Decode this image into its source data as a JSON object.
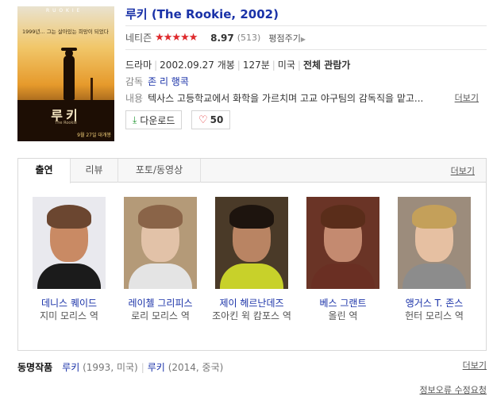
{
  "poster": {
    "top_text": "R U O K I E",
    "tagline": "1999년... 그는 살아있는 희망이 되었다",
    "title": "루키",
    "subtitle": "The Rookie",
    "date_text": "9월 27일 대개봉"
  },
  "movie": {
    "title": "루키 (The Rookie, 2002)",
    "rating_label": "네티즌",
    "rating": 8.97,
    "rating_text": "8.97",
    "rating_count": "(513)",
    "rate_link": "평점주기",
    "genre": "드라마",
    "release": "2002.09.27 개봉",
    "runtime": "127분",
    "country": "미국",
    "grade": "전체 관람가",
    "director_label": "감독",
    "director": "존 리 행콕",
    "plot_label": "내용",
    "plot": "텍사스 고등학교에서 화학을 가르치며 고교 야구팀의 감독직을 맡고...",
    "plot_more": "더보기",
    "download_label": "다운로드",
    "likes": "50"
  },
  "tabs": {
    "items": [
      "출연",
      "리뷰",
      "포토/동영상"
    ],
    "active": 0,
    "more": "더보기"
  },
  "cast": [
    {
      "name": "데니스 퀘이드",
      "role": "지미 모리스 역",
      "skin": "#c98a64",
      "hair": "#6b4630",
      "body": "#1b1b1b",
      "bg": "#e9e9ee"
    },
    {
      "name": "레이첼 그리피스",
      "role": "로리 모리스 역",
      "skin": "#e2c2a8",
      "hair": "#8a6448",
      "body": "#e4e4e4",
      "bg": "#b49a78"
    },
    {
      "name": "제이 헤르난데즈",
      "role": "조아킨 윅 캄포스 역",
      "skin": "#b98463",
      "hair": "#1d140e",
      "body": "#c8d12a",
      "bg": "#4a3a28"
    },
    {
      "name": "베스 그랜트",
      "role": "올린 역",
      "skin": "#c48a70",
      "hair": "#5a2d1a",
      "body": "#6a2f23",
      "bg": "#6a3426"
    },
    {
      "name": "앵거스 T. 존스",
      "role": "헌터 모리스 역",
      "skin": "#e6c0a2",
      "hair": "#c4a05a",
      "body": "#8c8c8c",
      "bg": "#9c8c7c"
    }
  ],
  "related": {
    "label": "동명작품",
    "items": [
      {
        "title": "루키",
        "meta": "(1993, 미국)"
      },
      {
        "title": "루키",
        "meta": "(2014, 중국)"
      }
    ],
    "more": "더보기"
  },
  "report_link": "정보오류 수정요청",
  "colors": {
    "link": "#1a32a8",
    "star": "#e0292c"
  }
}
